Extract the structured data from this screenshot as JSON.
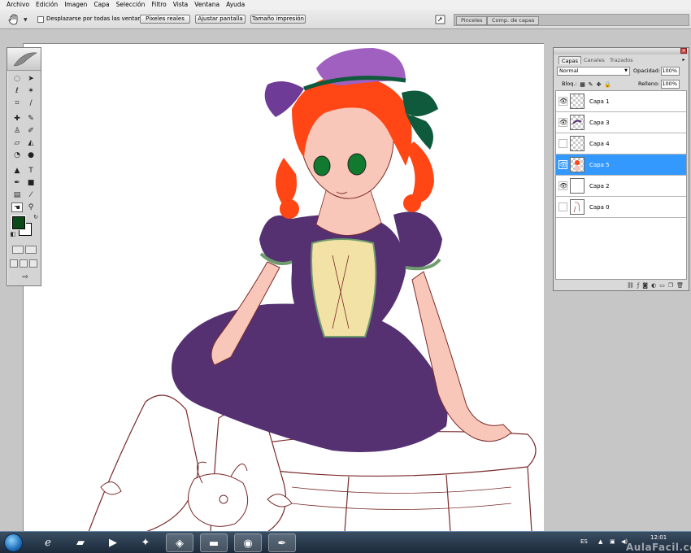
{
  "menu": {
    "items": [
      "Archivo",
      "Edición",
      "Imagen",
      "Capa",
      "Selección",
      "Filtro",
      "Vista",
      "Ventana",
      "Ayuda"
    ]
  },
  "options": {
    "tool_icon": "hand-icon",
    "scroll_all_label": "Desplazarse por todas las ventanas",
    "actual_pixels": "Píxeles reales",
    "fit_screen": "Ajustar pantalla",
    "print_size": "Tamaño impresión",
    "well_tabs": [
      "Pinceles",
      "Comp. de capas"
    ]
  },
  "toolbox": {
    "foreground_color": "#0c4a1a",
    "background_color": "#ffffff",
    "tools": [
      "marquee-icon",
      "move-icon",
      "lasso-icon",
      "magic-wand-icon",
      "crop-icon",
      "slice-icon",
      "healing-icon",
      "brush-icon",
      "stamp-icon",
      "history-brush-icon",
      "eraser-icon",
      "bucket-icon",
      "blur-icon",
      "dodge-icon",
      "path-select-icon",
      "type-icon",
      "pen-icon",
      "shape-icon",
      "notes-icon",
      "eyedropper-icon",
      "hand-icon",
      "zoom-icon"
    ]
  },
  "layers_panel": {
    "tabs": [
      "Capas",
      "Canales",
      "Trazados"
    ],
    "blend_mode": "Normal",
    "opacity_label": "Opacidad:",
    "opacity_value": "100%",
    "lock_label": "Bloq.:",
    "fill_label": "Relleno:",
    "fill_value": "100%",
    "layers": [
      {
        "name": "Capa 1",
        "visible": true,
        "selected": false
      },
      {
        "name": "Capa 3",
        "visible": true,
        "selected": false
      },
      {
        "name": "Capa 4",
        "visible": false,
        "selected": false
      },
      {
        "name": "Capa 5",
        "visible": true,
        "selected": true
      },
      {
        "name": "Capa 2",
        "visible": true,
        "selected": false
      },
      {
        "name": "Capa 0",
        "visible": false,
        "selected": false
      }
    ],
    "selected_color": "#3399ff"
  },
  "taskbar": {
    "language": "ES",
    "time": "12:01",
    "watermark": "AulaFacil.com"
  }
}
